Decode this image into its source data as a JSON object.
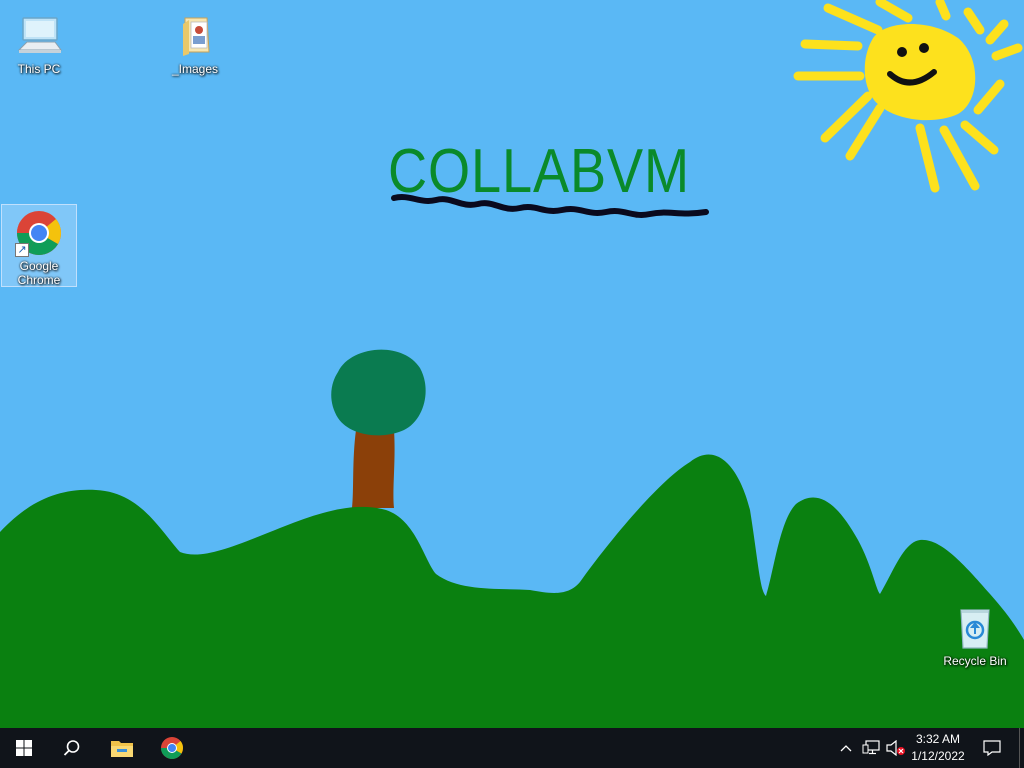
{
  "desktop": {
    "icons": [
      {
        "label": "This PC",
        "icon": "computer-icon"
      },
      {
        "label": "_Images",
        "icon": "folder-icon"
      },
      {
        "label": "Google Chrome",
        "icon": "chrome-icon",
        "selected": true
      },
      {
        "label": "Recycle Bin",
        "icon": "recycle-bin-icon"
      }
    ],
    "wallpaper": {
      "text": "COLLABVM",
      "sky_color": "#5ab8f5",
      "hill_color": "#0a8010",
      "sun_color": "#fde11d",
      "text_color": "#0a8a2a"
    }
  },
  "taskbar": {
    "start": "windows-start-icon",
    "search": "search-icon",
    "pinned": [
      "file-explorer-icon",
      "chrome-icon"
    ],
    "tray": {
      "icons": [
        "chevron-up-icon",
        "network-icon",
        "volume-muted-icon"
      ],
      "time": "3:32 AM",
      "date": "1/12/2022",
      "notification": "action-center-icon"
    }
  }
}
